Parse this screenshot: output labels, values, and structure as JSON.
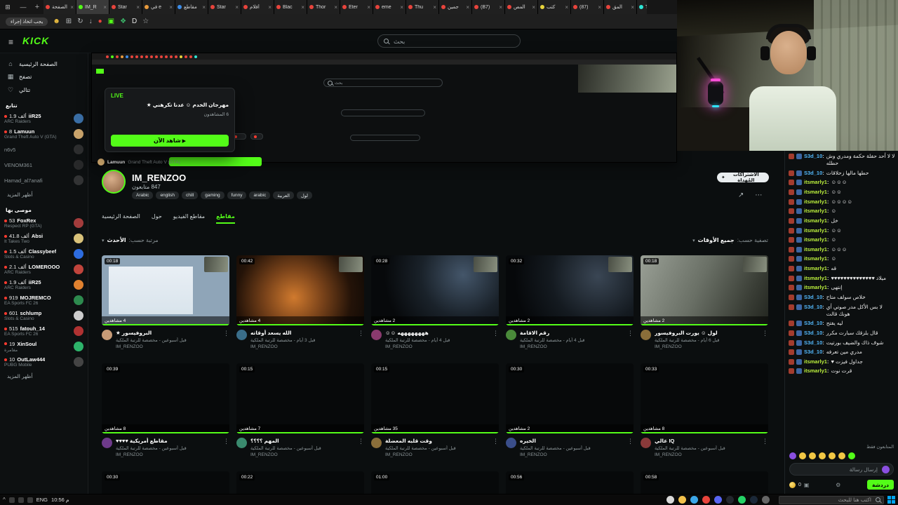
{
  "browser": {
    "tabs": [
      {
        "label": "الصفحة",
        "color": "#e8443c"
      },
      {
        "label": "IM_R",
        "color": "#53fc18",
        "active": true
      },
      {
        "label": "Star",
        "color": "#e8443c"
      },
      {
        "label": "في e",
        "color": "#e89a3c"
      },
      {
        "label": "مقاطع",
        "color": "#3c8ce8"
      },
      {
        "label": "Star",
        "color": "#e8443c"
      },
      {
        "label": "أفلام",
        "color": "#e8443c"
      },
      {
        "label": "Blac",
        "color": "#e8443c"
      },
      {
        "label": "Thor",
        "color": "#e8443c"
      },
      {
        "label": "Eter",
        "color": "#e8443c"
      },
      {
        "label": "eme",
        "color": "#e8443c"
      },
      {
        "label": "Thu",
        "color": "#e8443c"
      },
      {
        "label": "جمين",
        "color": "#e8443c"
      },
      {
        "label": "(B7)",
        "color": "#e8443c"
      },
      {
        "label": "المص",
        "color": "#e8443c"
      },
      {
        "label": "كتب",
        "color": "#e8d43c"
      },
      {
        "label": "(87)",
        "color": "#e8443c"
      },
      {
        "label": "المق",
        "color": "#e8443c"
      },
      {
        "label": "TikT",
        "color": "#2ee6d6"
      }
    ],
    "new_tab_label": "+",
    "toolbar": {
      "action_label": "يجب اتخاذ إجراء",
      "icons": [
        {
          "name": "profile-icon",
          "glyph": "☻",
          "color": "#f5c542"
        },
        {
          "name": "grid-icon",
          "glyph": "⊞",
          "color": "#b9bcbe"
        },
        {
          "name": "refresh-icon",
          "glyph": "↻",
          "color": "#b9bcbe"
        },
        {
          "name": "download-icon",
          "glyph": "↓",
          "color": "#b9bcbe"
        },
        {
          "name": "record-icon",
          "glyph": "●",
          "color": "#e8443c"
        },
        {
          "name": "capture-icon",
          "glyph": "▣",
          "color": "#53fc18"
        },
        {
          "name": "leaf-extension-icon",
          "glyph": "❖",
          "color": "#3cb96a"
        },
        {
          "name": "dark-extension-icon",
          "glyph": "D",
          "color": "#e2e2e2"
        },
        {
          "name": "bookmark-star-icon",
          "glyph": "☆",
          "color": "#b9bcbe"
        }
      ]
    }
  },
  "header": {
    "logo": "KICK",
    "search_placeholder": "بحث"
  },
  "sidebar": {
    "nav": [
      {
        "icon": "⌂",
        "label": "الصفحة الرئيسية"
      },
      {
        "icon": "▦",
        "label": "تصفح"
      },
      {
        "icon": "♡",
        "label": "تتالي"
      }
    ],
    "following_header": "تتابع",
    "following": [
      {
        "count": "1.9 ألف",
        "name": "iiR25",
        "game": "ARC Raiders",
        "color": "#3a6ea5"
      },
      {
        "count": "8",
        "name": "Lamuun",
        "game": "Grand Theft Auto V (GTA)",
        "color": "#c9a36b"
      },
      {
        "name": "n6v5",
        "game": "",
        "color": "#555555",
        "offline": true
      },
      {
        "name": "VENOM361",
        "game": "",
        "color": "#4a4a4a",
        "offline": true
      },
      {
        "name": "Hamad_al7anafi",
        "game": "",
        "color": "#5f5f5f",
        "offline": true
      }
    ],
    "show_more_1": "أظهر المزيد",
    "recommended_header": "موصى بها",
    "recommended": [
      {
        "count": "53",
        "name": "FoxRex",
        "game": "Respect RP (GTA)",
        "color": "#a33c3c"
      },
      {
        "count": "41.8 ألف",
        "name": "Absi",
        "game": "It Takes Two",
        "color": "#d9c27a"
      },
      {
        "count": "1.5 ألف",
        "name": "Classybeef",
        "game": "Slots & Casino",
        "color": "#2d6cdf"
      },
      {
        "count": "2.1 ألف",
        "name": "LOMEROOO",
        "game": "ARC Raiders",
        "color": "#c0443c"
      },
      {
        "count": "1.9 ألف",
        "name": "iiR25",
        "game": "ARC Raiders",
        "color": "#e0812f"
      },
      {
        "count": "919",
        "name": "MOJREMCO",
        "game": "EA Sports FC 26",
        "color": "#2d8a4e"
      },
      {
        "count": "601",
        "name": "schlump",
        "game": "Slots & Casino",
        "color": "#cccccc"
      },
      {
        "count": "515",
        "name": "fatouh_14",
        "game": "EA Sports FC 26",
        "color": "#b03232"
      },
      {
        "count": "19",
        "name": "XinSoul",
        "game": "مغامرة",
        "color": "#2db36a"
      },
      {
        "count": "10",
        "name": "OutLaw444",
        "game": "PUBG Mobile",
        "color": "#444444"
      }
    ],
    "show_more_2": "أظهر المزيد"
  },
  "preview": {
    "live_badge": "LIVE",
    "title": "مهرجان الخدم ☺ عدنا تكرهني ★",
    "viewers": "6 المشاهدون",
    "watch_button": "شاهد الآن",
    "channel": "Lamuun",
    "game": "Grand Theft Auto V (GTA)",
    "mini_search": "بحث"
  },
  "channel": {
    "name": "IM_RENZOO",
    "followers": "847 متابعون",
    "tags": [
      "Arabic",
      "english",
      "chill",
      "gaming",
      "funny",
      "arabic",
      "العربية",
      "لول"
    ],
    "gift_button": "الاشتراكات المُهداة",
    "tabs": [
      {
        "label": "الصفحة الرئيسية"
      },
      {
        "label": "حول"
      },
      {
        "label": "مقاطع الفيديو"
      },
      {
        "label": "مقاطع",
        "active": true
      }
    ],
    "sort_label": "مرتبة حسب:",
    "sort_value": "الأحدث",
    "filter_label": "تصفية حسب:",
    "filter_value": "جميع الأوقات"
  },
  "clips": {
    "channel": "IM_RENZOO",
    "category_suffix": "مخصصة للرتبة الملكية",
    "row1": [
      {
        "dur": "00:18",
        "viewers": "4 مشاهدين",
        "title": "البروفيسور ★",
        "ago": "قبل أسبوعين",
        "av": "#c79b77"
      },
      {
        "dur": "00:42",
        "viewers": "4 مشاهدين",
        "title": "الله يسعد أوقاته",
        "ago": "قبل 3 أيام",
        "av": "#3a6e8a"
      },
      {
        "dur": "00:28",
        "viewers": "2 مشاهدين",
        "title": "ههههههههه ☺☺",
        "ago": "قبل 4 أيام",
        "av": "#8a3a6e"
      },
      {
        "dur": "00:32",
        "viewers": "2 مشاهدين",
        "title": "رقم الاقامة",
        "ago": "قبل 4 أيام",
        "av": "#4a8a3a"
      },
      {
        "dur": "00:18",
        "viewers": "2 مشاهدين",
        "title": "لول ☺ يورت البروفيسور",
        "ago": "قبل 6 أيام",
        "av": "#8a6e3a"
      }
    ],
    "row2": [
      {
        "dur": "00:39",
        "viewers": "8 مشاهدين",
        "title": "مقاطع أمريكية ♥♥♥♥",
        "ago": "قبل أسبوعين",
        "av": "#6e3a8a"
      },
      {
        "dur": "00:15",
        "viewers": "7 مشاهدين",
        "title": "المهم ؟؟؟؟",
        "ago": "قبل أسبوعين",
        "av": "#3a8a6e"
      },
      {
        "dur": "00:15",
        "viewers": "35 مشاهدين",
        "title": "وقت قلبه المعضلة",
        "ago": "قبل أسبوعين",
        "av": "#8a6e3a"
      },
      {
        "dur": "00:30",
        "viewers": "2 مشاهدين",
        "title": "الخيره",
        "ago": "قبل أسبوعين",
        "av": "#3a4e8a"
      },
      {
        "dur": "00:33",
        "viewers": "8 مشاهدين",
        "title": "IQ عالي",
        "ago": "قبل أسبوعين",
        "av": "#8a3a3a"
      }
    ],
    "row3_durations": [
      "00:30",
      "00:22",
      "01:00",
      "00:56",
      "00:58"
    ]
  },
  "chat": {
    "messages": [
      {
        "user": "S3d_10",
        "color": "#53b9fc",
        "text": "لا لا أحد حفلة حكمة ومدري وش حطله"
      },
      {
        "user": "S3d_10",
        "color": "#53b9fc",
        "text": "حطها مالها زحلاقات"
      },
      {
        "user": "itsmarly1",
        "color": "#bdf23d",
        "text": "☺☺☺"
      },
      {
        "user": "itsmarly1",
        "color": "#bdf23d",
        "text": "☺☺"
      },
      {
        "user": "itsmarly1",
        "color": "#bdf23d",
        "text": "☺☺☺☺"
      },
      {
        "user": "itsmarly1",
        "color": "#bdf23d",
        "text": "☺"
      },
      {
        "user": "itsmarly1",
        "color": "#bdf23d",
        "text": "خل"
      },
      {
        "user": "itsmarly1",
        "color": "#bdf23d",
        "text": "☺☺"
      },
      {
        "user": "itsmarly1",
        "color": "#bdf23d",
        "text": "☺"
      },
      {
        "user": "itsmarly1",
        "color": "#bdf23d",
        "text": "☺☺☺"
      },
      {
        "user": "itsmarly1",
        "color": "#bdf23d",
        "text": "☺"
      },
      {
        "user": "itsmarly1",
        "color": "#bdf23d",
        "text": "قه"
      },
      {
        "user": "itsmarly1",
        "color": "#bdf23d",
        "text": "ميلاد ♥♥♥♥♥♥♥♥♥♥♥♥♥♥"
      },
      {
        "user": "itsmarly1",
        "color": "#bdf23d",
        "text": "إنتهى"
      },
      {
        "user": "S3d_10",
        "color": "#53b9fc",
        "text": "خلاص سولف متاح"
      },
      {
        "user": "S3d_10",
        "color": "#53b9fc",
        "text": "لا بس الأكل مدر صوتي أي هونك قالت"
      },
      {
        "user": "S3d_10",
        "color": "#53b9fc",
        "text": "ليه يفتح"
      },
      {
        "user": "S3d_10",
        "color": "#53b9fc",
        "text": "قال بلزقك سبارت مكرر"
      },
      {
        "user": "S3d_10",
        "color": "#53b9fc",
        "text": "شوف ذاك والضيف بورتيت"
      },
      {
        "user": "S3d_10",
        "color": "#53b9fc",
        "text": "مدري مين تعرفه"
      },
      {
        "user": "itsmarly1",
        "color": "#bdf23d",
        "text": "جداول فيزت ♥"
      },
      {
        "user": "itsmarly1",
        "color": "#bdf23d",
        "text": "قرت نوت"
      }
    ],
    "followers_only": "المتابعون فقط",
    "quick_emotes": [
      "monster",
      "laugh",
      "smile",
      "grin",
      "wink",
      "cool",
      "gift"
    ],
    "coins": "0",
    "input_placeholder": "إرسال رسالة",
    "send_button": "دردشة"
  },
  "taskbar": {
    "apps": [
      {
        "name": "taskbar-volume-icon",
        "color": "#d8d8d8"
      },
      {
        "name": "taskbar-explorer-icon",
        "color": "#f2c14b"
      },
      {
        "name": "taskbar-edge-icon",
        "color": "#3ca7e8"
      },
      {
        "name": "taskbar-chrome-icon",
        "color": "#e8443c"
      },
      {
        "name": "taskbar-discord-icon",
        "color": "#5865f2"
      },
      {
        "name": "taskbar-obs-icon",
        "color": "#23272e"
      },
      {
        "name": "taskbar-whatsapp-icon",
        "color": "#25d366"
      },
      {
        "name": "taskbar-steam-icon",
        "color": "#1b2838"
      },
      {
        "name": "taskbar-epic-icon",
        "color": "#666666"
      }
    ],
    "search_placeholder": "اكتب هنا للبحث",
    "language": "ENG",
    "time": "10:56 م"
  }
}
